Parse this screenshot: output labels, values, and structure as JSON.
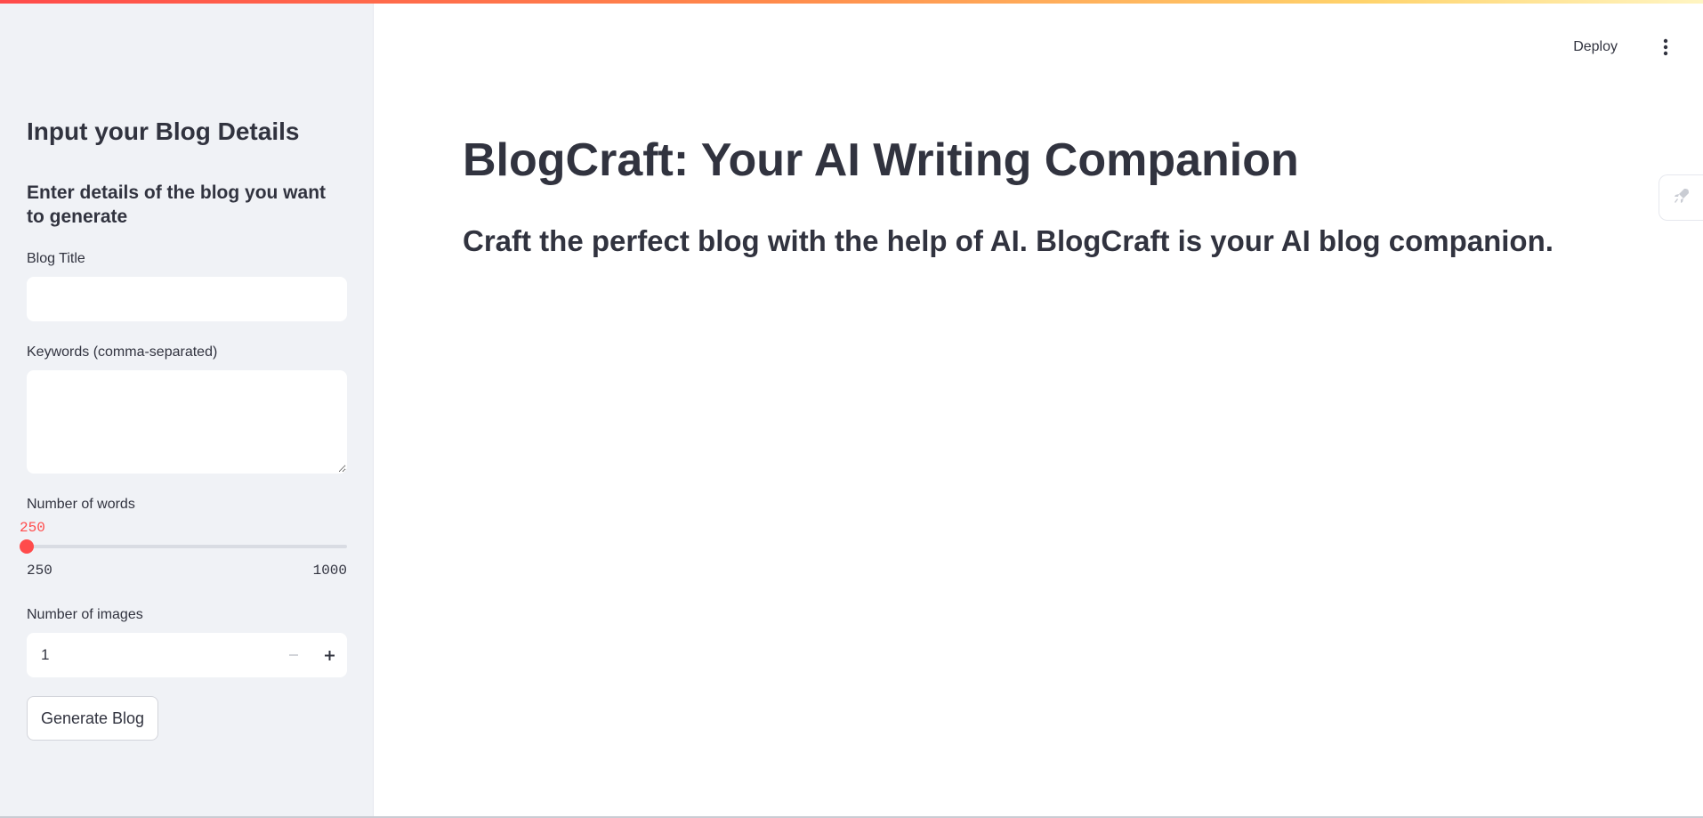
{
  "colors": {
    "accent": "#ff4b4b",
    "sidebar_bg": "#f0f2f6",
    "text": "#31333f"
  },
  "header": {
    "deploy_label": "Deploy",
    "menu_icon": "more-vertical-icon"
  },
  "sidebar": {
    "header": "Input your Blog Details",
    "subheader": "Enter details of the blog you want to generate",
    "blog_title": {
      "label": "Blog Title",
      "value": "",
      "placeholder": ""
    },
    "keywords": {
      "label": "Keywords (comma-separated)",
      "value": "",
      "placeholder": ""
    },
    "word_count": {
      "label": "Number of words",
      "value": 250,
      "value_label": "250",
      "min": 250,
      "max": 1000,
      "min_label": "250",
      "max_label": "1000"
    },
    "image_count": {
      "label": "Number of images",
      "value": "1",
      "minus_icon": "minus-icon",
      "plus_icon": "plus-icon"
    },
    "generate_button": "Generate Blog"
  },
  "main": {
    "title": "BlogCraft: Your AI Writing Companion",
    "subtitle": "Craft the perfect blog with the help of AI. BlogCraft is your AI blog companion."
  },
  "side_tab": {
    "icon": "rocket-icon"
  }
}
